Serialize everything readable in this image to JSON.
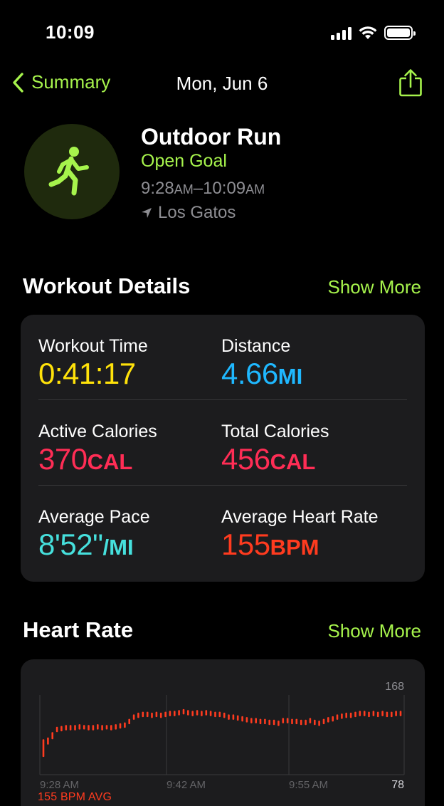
{
  "status": {
    "time": "10:09"
  },
  "nav": {
    "back_label": "Summary",
    "title": "Mon, Jun 6"
  },
  "workout": {
    "title": "Outdoor Run",
    "goal": "Open Goal",
    "start_time": "9:28",
    "start_period": "AM",
    "end_time": "10:09",
    "end_period": "AM",
    "location": "Los Gatos"
  },
  "details": {
    "section_title": "Workout Details",
    "show_more": "Show More",
    "items": [
      {
        "label": "Workout Time",
        "value": "0:41:17",
        "unit": "",
        "color": "#ffe20a"
      },
      {
        "label": "Distance",
        "value": "4.66",
        "unit": "MI",
        "color": "#1fb8ff"
      },
      {
        "label": "Active Calories",
        "value": "370",
        "unit": "CAL",
        "color": "#ff2d55"
      },
      {
        "label": "Total Calories",
        "value": "456",
        "unit": "CAL",
        "color": "#ff2d55"
      },
      {
        "label": "Average Pace",
        "value": "8'52\"",
        "unit": "/MI",
        "color": "#46e0dd"
      },
      {
        "label": "Average Heart Rate",
        "value": "155",
        "unit": "BPM",
        "color": "#ff3b1f"
      }
    ]
  },
  "heart_rate": {
    "section_title": "Heart Rate",
    "show_more": "Show More",
    "avg_label": "155 BPM AVG"
  },
  "chart_data": {
    "type": "bar",
    "x_tick_labels": [
      "9:28 AM",
      "9:42 AM",
      "9:55 AM"
    ],
    "y_max_label": "168",
    "y_min_label": "78",
    "ylim": [
      78,
      168
    ],
    "color": "#ff3b1f",
    "grid": true,
    "series": [
      {
        "values": [
          [
            98,
            118
          ],
          [
            112,
            120
          ],
          [
            118,
            126
          ],
          [
            126,
            132
          ],
          [
            127,
            133
          ],
          [
            128,
            134
          ],
          [
            128,
            134
          ],
          [
            128,
            134
          ],
          [
            129,
            135
          ],
          [
            129,
            134
          ],
          [
            128,
            134
          ],
          [
            128,
            134
          ],
          [
            129,
            135
          ],
          [
            128,
            134
          ],
          [
            129,
            134
          ],
          [
            128,
            134
          ],
          [
            129,
            135
          ],
          [
            130,
            136
          ],
          [
            131,
            137
          ],
          [
            135,
            141
          ],
          [
            140,
            146
          ],
          [
            142,
            148
          ],
          [
            143,
            149
          ],
          [
            143,
            149
          ],
          [
            142,
            148
          ],
          [
            143,
            149
          ],
          [
            142,
            148
          ],
          [
            143,
            149
          ],
          [
            144,
            150
          ],
          [
            144,
            150
          ],
          [
            145,
            151
          ],
          [
            146,
            152
          ],
          [
            145,
            151
          ],
          [
            144,
            150
          ],
          [
            145,
            151
          ],
          [
            144,
            150
          ],
          [
            145,
            151
          ],
          [
            144,
            150
          ],
          [
            143,
            149
          ],
          [
            143,
            149
          ],
          [
            142,
            148
          ],
          [
            140,
            146
          ],
          [
            140,
            146
          ],
          [
            139,
            145
          ],
          [
            138,
            144
          ],
          [
            137,
            143
          ],
          [
            136,
            142
          ],
          [
            136,
            142
          ],
          [
            135,
            141
          ],
          [
            135,
            141
          ],
          [
            134,
            140
          ],
          [
            134,
            140
          ],
          [
            133,
            139
          ],
          [
            136,
            142
          ],
          [
            136,
            142
          ],
          [
            135,
            141
          ],
          [
            135,
            141
          ],
          [
            134,
            140
          ],
          [
            134,
            140
          ],
          [
            136,
            142
          ],
          [
            134,
            140
          ],
          [
            133,
            139
          ],
          [
            135,
            141
          ],
          [
            137,
            143
          ],
          [
            138,
            144
          ],
          [
            140,
            146
          ],
          [
            141,
            147
          ],
          [
            142,
            148
          ],
          [
            142,
            148
          ],
          [
            143,
            149
          ],
          [
            144,
            150
          ],
          [
            144,
            150
          ],
          [
            143,
            149
          ],
          [
            144,
            150
          ],
          [
            143,
            149
          ],
          [
            144,
            150
          ],
          [
            143,
            149
          ],
          [
            143,
            149
          ],
          [
            144,
            150
          ],
          [
            144,
            150
          ]
        ]
      }
    ]
  }
}
